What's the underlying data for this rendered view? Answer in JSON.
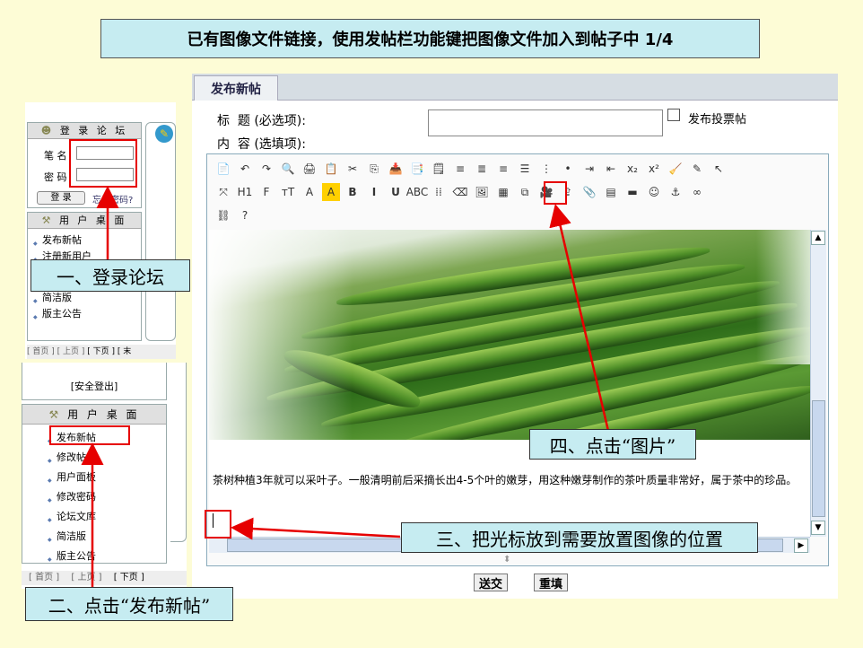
{
  "title": "已有图像文件链接，使用发帖栏功能键把图像文件加入到帖子中 1/4",
  "login": {
    "header": "登 录 论 坛",
    "username_label": "笔 名",
    "password_label": "密 码",
    "login_button": "登 录",
    "forgot_link": "忘记密码?"
  },
  "user_desk_top": {
    "header": "用 户 桌 面",
    "items": [
      "发布新帖",
      "注册新用户",
      "简洁版",
      "版主公告"
    ]
  },
  "pager_top": [
    "[ 首页 ]",
    "[ 上页 ]",
    "[ 下页 ]",
    "[ 末"
  ],
  "logout": "[安全登出]",
  "user_desk": {
    "header": "用 户 桌 面",
    "items": [
      "发布新帖",
      "修改帖子",
      "用户面板",
      "修改密码",
      "论坛文库",
      "简洁版",
      "版主公告"
    ]
  },
  "pager_bottom": [
    "[ 首页 ]",
    "[ 上页 ]",
    "[ 下页 ]"
  ],
  "post": {
    "tab": "发布新帖",
    "subject_label": "标  题 (必选项):",
    "content_label": "内  容 (选填项):",
    "poll_label": "发布投票帖",
    "content_text": "茶树种植3年就可以采叶子。一般清明前后采摘长出4-5个叶的嫩芽，用这种嫩芽制作的茶叶质量非常好，属于茶中的珍品。",
    "submit": "送交",
    "reset": "重填"
  },
  "toolbar": {
    "row1": [
      "📄",
      "↶",
      "↷",
      "🔍",
      "🖨",
      "📋",
      "✂",
      "⎘",
      "📥",
      "📑",
      "🗒",
      "≡",
      "≣",
      "≡",
      "☰",
      "⋮",
      "•",
      "⇥",
      "⇤",
      "x₂",
      "x²",
      "🧹",
      "✎",
      "↖"
    ],
    "row2": [
      "⤧",
      "H1",
      "F",
      "тT",
      "A",
      "A",
      "B",
      "I",
      "U",
      "ABC",
      "⁞⁞",
      "⌫",
      "🖼",
      "▦",
      "⧉",
      "🎥",
      "⇪",
      "📎",
      "▤",
      "▬",
      "☺",
      "⚓",
      "∞"
    ],
    "row3": [
      "⛓",
      "?"
    ]
  },
  "callouts": {
    "step1": "一、登录论坛",
    "step2": "二、点击“发布新帖”",
    "step3": "三、把光标放到需要放置图像的位置",
    "step4": "四、点击“图片”"
  },
  "colors": {
    "background": "#fdfcd6",
    "callout": "#c6ecf1",
    "highlight": "#e60000"
  }
}
